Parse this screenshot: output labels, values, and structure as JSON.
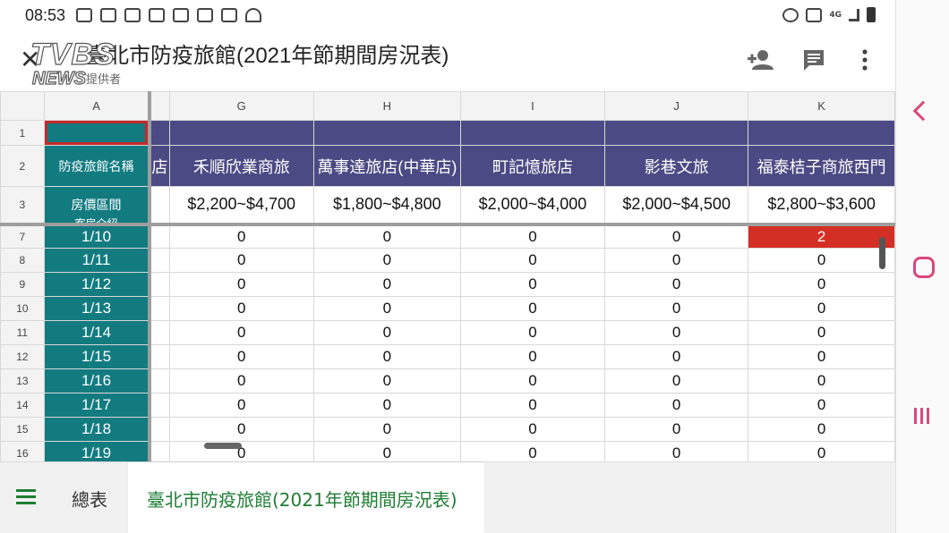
{
  "status_bar": {
    "time": "08:53",
    "left_icons": [
      "ga-icon",
      "apple-icon",
      "ltn-icon",
      "news-icon",
      "fullscreen-icon",
      "line-icon",
      "screenshot-icon",
      "wifi-icon"
    ],
    "right_icons": [
      "alarm-icon",
      "mute-icon",
      "signal-4g-icon",
      "battery-icon"
    ],
    "signal_label": "4G"
  },
  "header": {
    "close_glyph": "✕",
    "title": "臺北市防疫旅館(2021年節期間房況表)",
    "subtitle": "提供者",
    "watermark_line1": "TVBS",
    "watermark_line2": "NEWS",
    "add_person_glyph": "👤",
    "comment_glyph": "▤",
    "more_glyph": "⋮"
  },
  "sheet": {
    "column_headers": [
      "A",
      "G",
      "H",
      "I",
      "J",
      "K"
    ],
    "header_row_labels": [
      "1",
      "2",
      "3"
    ],
    "row2": {
      "a": "防疫旅館名稱",
      "partial": "店",
      "hotels": [
        "禾順欣業商旅",
        "萬事達旅店(中華店)",
        "町記憶旅店",
        "影巷文旅",
        "福泰桔子商旅西門"
      ]
    },
    "row3": {
      "a": "房價區間",
      "a_peek": "客房介紹",
      "prices": [
        "$2,200~$4,700",
        "$1,800~$4,800",
        "$2,000~$4,000",
        "$2,000~$4,500",
        "$2,800~$3,600"
      ]
    },
    "rows": [
      {
        "num": "7",
        "date": "1/10",
        "values": [
          "0",
          "0",
          "0",
          "0",
          "2"
        ],
        "hot_index": 4
      },
      {
        "num": "8",
        "date": "1/11",
        "values": [
          "0",
          "0",
          "0",
          "0",
          "0"
        ]
      },
      {
        "num": "9",
        "date": "1/12",
        "values": [
          "0",
          "0",
          "0",
          "0",
          "0"
        ]
      },
      {
        "num": "10",
        "date": "1/13",
        "values": [
          "0",
          "0",
          "0",
          "0",
          "0"
        ]
      },
      {
        "num": "11",
        "date": "1/14",
        "values": [
          "0",
          "0",
          "0",
          "0",
          "0"
        ]
      },
      {
        "num": "12",
        "date": "1/15",
        "values": [
          "0",
          "0",
          "0",
          "0",
          "0"
        ]
      },
      {
        "num": "13",
        "date": "1/16",
        "values": [
          "0",
          "0",
          "0",
          "0",
          "0"
        ]
      },
      {
        "num": "14",
        "date": "1/17",
        "values": [
          "0",
          "0",
          "0",
          "0",
          "0"
        ]
      },
      {
        "num": "15",
        "date": "1/18",
        "values": [
          "0",
          "0",
          "0",
          "0",
          "0"
        ]
      },
      {
        "num": "16",
        "date": "1/19",
        "values": [
          "0",
          "0",
          "0",
          "0",
          "0"
        ]
      }
    ],
    "colors": {
      "header_band": "#4b4a84",
      "frozen_column": "#127b80",
      "hot_cell": "#d32f24",
      "selected_border": "#c62828"
    }
  },
  "tabs": {
    "menu_icon": "hamburger-icon",
    "items": [
      "總表",
      "臺北市防疫旅館(2021年節期間房況表)"
    ],
    "active_index": 1,
    "active_color": "#1e7e34"
  },
  "nav": {
    "icons": [
      "back-icon",
      "home-icon",
      "recent-apps-icon"
    ],
    "color": "#d8497c"
  }
}
